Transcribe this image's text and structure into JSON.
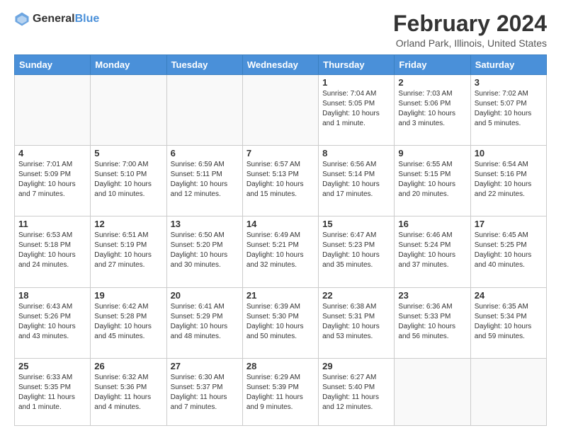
{
  "logo": {
    "general": "General",
    "blue": "Blue"
  },
  "title": "February 2024",
  "location": "Orland Park, Illinois, United States",
  "days_of_week": [
    "Sunday",
    "Monday",
    "Tuesday",
    "Wednesday",
    "Thursday",
    "Friday",
    "Saturday"
  ],
  "weeks": [
    [
      {
        "day": "",
        "info": ""
      },
      {
        "day": "",
        "info": ""
      },
      {
        "day": "",
        "info": ""
      },
      {
        "day": "",
        "info": ""
      },
      {
        "day": "1",
        "info": "Sunrise: 7:04 AM\nSunset: 5:05 PM\nDaylight: 10 hours\nand 1 minute."
      },
      {
        "day": "2",
        "info": "Sunrise: 7:03 AM\nSunset: 5:06 PM\nDaylight: 10 hours\nand 3 minutes."
      },
      {
        "day": "3",
        "info": "Sunrise: 7:02 AM\nSunset: 5:07 PM\nDaylight: 10 hours\nand 5 minutes."
      }
    ],
    [
      {
        "day": "4",
        "info": "Sunrise: 7:01 AM\nSunset: 5:09 PM\nDaylight: 10 hours\nand 7 minutes."
      },
      {
        "day": "5",
        "info": "Sunrise: 7:00 AM\nSunset: 5:10 PM\nDaylight: 10 hours\nand 10 minutes."
      },
      {
        "day": "6",
        "info": "Sunrise: 6:59 AM\nSunset: 5:11 PM\nDaylight: 10 hours\nand 12 minutes."
      },
      {
        "day": "7",
        "info": "Sunrise: 6:57 AM\nSunset: 5:13 PM\nDaylight: 10 hours\nand 15 minutes."
      },
      {
        "day": "8",
        "info": "Sunrise: 6:56 AM\nSunset: 5:14 PM\nDaylight: 10 hours\nand 17 minutes."
      },
      {
        "day": "9",
        "info": "Sunrise: 6:55 AM\nSunset: 5:15 PM\nDaylight: 10 hours\nand 20 minutes."
      },
      {
        "day": "10",
        "info": "Sunrise: 6:54 AM\nSunset: 5:16 PM\nDaylight: 10 hours\nand 22 minutes."
      }
    ],
    [
      {
        "day": "11",
        "info": "Sunrise: 6:53 AM\nSunset: 5:18 PM\nDaylight: 10 hours\nand 24 minutes."
      },
      {
        "day": "12",
        "info": "Sunrise: 6:51 AM\nSunset: 5:19 PM\nDaylight: 10 hours\nand 27 minutes."
      },
      {
        "day": "13",
        "info": "Sunrise: 6:50 AM\nSunset: 5:20 PM\nDaylight: 10 hours\nand 30 minutes."
      },
      {
        "day": "14",
        "info": "Sunrise: 6:49 AM\nSunset: 5:21 PM\nDaylight: 10 hours\nand 32 minutes."
      },
      {
        "day": "15",
        "info": "Sunrise: 6:47 AM\nSunset: 5:23 PM\nDaylight: 10 hours\nand 35 minutes."
      },
      {
        "day": "16",
        "info": "Sunrise: 6:46 AM\nSunset: 5:24 PM\nDaylight: 10 hours\nand 37 minutes."
      },
      {
        "day": "17",
        "info": "Sunrise: 6:45 AM\nSunset: 5:25 PM\nDaylight: 10 hours\nand 40 minutes."
      }
    ],
    [
      {
        "day": "18",
        "info": "Sunrise: 6:43 AM\nSunset: 5:26 PM\nDaylight: 10 hours\nand 43 minutes."
      },
      {
        "day": "19",
        "info": "Sunrise: 6:42 AM\nSunset: 5:28 PM\nDaylight: 10 hours\nand 45 minutes."
      },
      {
        "day": "20",
        "info": "Sunrise: 6:41 AM\nSunset: 5:29 PM\nDaylight: 10 hours\nand 48 minutes."
      },
      {
        "day": "21",
        "info": "Sunrise: 6:39 AM\nSunset: 5:30 PM\nDaylight: 10 hours\nand 50 minutes."
      },
      {
        "day": "22",
        "info": "Sunrise: 6:38 AM\nSunset: 5:31 PM\nDaylight: 10 hours\nand 53 minutes."
      },
      {
        "day": "23",
        "info": "Sunrise: 6:36 AM\nSunset: 5:33 PM\nDaylight: 10 hours\nand 56 minutes."
      },
      {
        "day": "24",
        "info": "Sunrise: 6:35 AM\nSunset: 5:34 PM\nDaylight: 10 hours\nand 59 minutes."
      }
    ],
    [
      {
        "day": "25",
        "info": "Sunrise: 6:33 AM\nSunset: 5:35 PM\nDaylight: 11 hours\nand 1 minute."
      },
      {
        "day": "26",
        "info": "Sunrise: 6:32 AM\nSunset: 5:36 PM\nDaylight: 11 hours\nand 4 minutes."
      },
      {
        "day": "27",
        "info": "Sunrise: 6:30 AM\nSunset: 5:37 PM\nDaylight: 11 hours\nand 7 minutes."
      },
      {
        "day": "28",
        "info": "Sunrise: 6:29 AM\nSunset: 5:39 PM\nDaylight: 11 hours\nand 9 minutes."
      },
      {
        "day": "29",
        "info": "Sunrise: 6:27 AM\nSunset: 5:40 PM\nDaylight: 11 hours\nand 12 minutes."
      },
      {
        "day": "",
        "info": ""
      },
      {
        "day": "",
        "info": ""
      }
    ]
  ]
}
